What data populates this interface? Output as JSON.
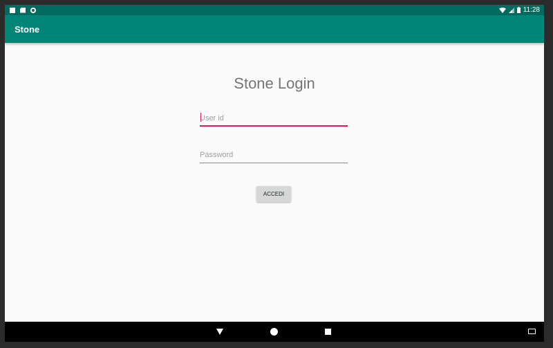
{
  "status_bar": {
    "time": "11:28",
    "left_icons": [
      "notification-icon",
      "sd-card-icon",
      "sync-icon"
    ],
    "right_icons": [
      "wifi-icon",
      "signal-icon",
      "battery-icon"
    ]
  },
  "app_bar": {
    "title": "Stone",
    "color": "#008577"
  },
  "login": {
    "title": "Stone Login",
    "user_id_placeholder": "User id",
    "password_placeholder": "Password",
    "button_label": "ACCEDI",
    "accent_color": "#d81b60"
  },
  "nav_bar": {
    "icons": [
      "back-icon",
      "home-icon",
      "recents-icon",
      "keyboard-icon"
    ]
  }
}
